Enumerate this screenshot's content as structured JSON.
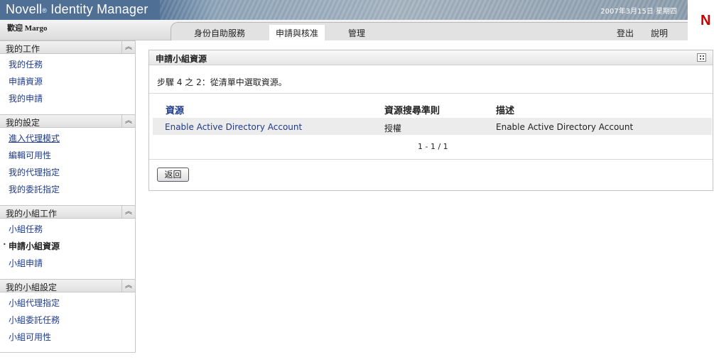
{
  "header": {
    "product": "Novell",
    "product_mark": "®",
    "product_suffix": " Identity Manager",
    "date": "2007年3月15日 星期四",
    "logo": "N",
    "welcome": "歡迎 Margo",
    "tabs": [
      {
        "label": "身份自助服務"
      },
      {
        "label": "申請與核准",
        "active": true
      },
      {
        "label": "管理"
      }
    ],
    "logout": "登出",
    "help": "說明"
  },
  "sidebar": {
    "sections": [
      {
        "title": "我的工作",
        "items": [
          "我的任務",
          "申請資源",
          "我的申請"
        ]
      },
      {
        "title": "我的設定",
        "items": [
          "進入代理模式",
          "編輯可用性",
          "我的代理指定",
          "我的委託指定"
        ]
      },
      {
        "title": "我的小組工作",
        "items": [
          "小組任務",
          "申請小組資源",
          "小組申請"
        ]
      },
      {
        "title": "我的小組設定",
        "items": [
          "小組代理指定",
          "小組委託任務",
          "小組可用性"
        ]
      }
    ],
    "collapse_glyph": "︽"
  },
  "panel": {
    "title": "申請小組資源",
    "step": "步驟 4 之 2：從清單中選取資源。",
    "columns": [
      "資源",
      "資源搜尋準則",
      "描述"
    ],
    "rows": [
      {
        "resource": "Enable Active Directory Account",
        "criteria": "授權",
        "description": "Enable Active Directory Account"
      }
    ],
    "pager": "1 - 1 / 1",
    "back_label": "返回"
  },
  "colors": {
    "banner": "#4f6f94",
    "link": "#1f3b8a",
    "logo_red": "#cc0000"
  }
}
